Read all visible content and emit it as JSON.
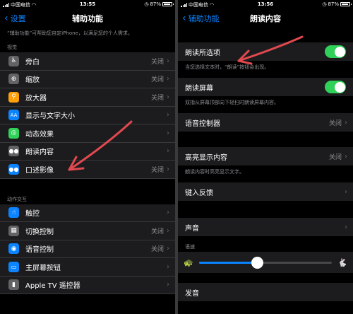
{
  "left": {
    "status": {
      "carrier": "中国电信",
      "time": "13:55",
      "battery": "87%"
    },
    "nav": {
      "back": "设置",
      "title": "辅助功能"
    },
    "description": "“辅助功能”可帮助您自定iPhone，以满足您的个人需求。",
    "vision_label": "视觉",
    "vision_items": [
      {
        "label": "旁白",
        "value": "关闭",
        "icon": "voiceover-icon",
        "color": "#636366",
        "glyph": "♿"
      },
      {
        "label": "缩放",
        "value": "关闭",
        "icon": "zoom-icon",
        "color": "#636366",
        "glyph": "⊕"
      },
      {
        "label": "放大器",
        "value": "关闭",
        "icon": "magnifier-icon",
        "color": "#ff9f0a",
        "glyph": "⚲"
      },
      {
        "label": "显示与文字大小",
        "value": "",
        "icon": "text-size-icon",
        "color": "#0a84ff",
        "glyph": "AA"
      },
      {
        "label": "动态效果",
        "value": "",
        "icon": "motion-icon",
        "color": "#30d158",
        "glyph": "◎"
      },
      {
        "label": "朗读内容",
        "value": "",
        "icon": "spoken-content-icon",
        "color": "#636366",
        "glyph": "💬"
      },
      {
        "label": "口述影像",
        "value": "关闭",
        "icon": "audio-description-icon",
        "color": "#0a84ff",
        "glyph": "💬"
      }
    ],
    "interaction_label": "动作交互",
    "interaction_items": [
      {
        "label": "触控",
        "value": "",
        "icon": "touch-icon",
        "color": "#0a84ff",
        "glyph": "☝"
      },
      {
        "label": "切换控制",
        "value": "关闭",
        "icon": "switch-control-icon",
        "color": "#636366",
        "glyph": "▦"
      },
      {
        "label": "语音控制",
        "value": "关闭",
        "icon": "voice-control-icon",
        "color": "#0a84ff",
        "glyph": "◉"
      },
      {
        "label": "主屏幕按钮",
        "value": "",
        "icon": "home-button-icon",
        "color": "#0a84ff",
        "glyph": "⬜"
      },
      {
        "label": "Apple TV 遥控器",
        "value": "",
        "icon": "remote-icon",
        "color": "#636366",
        "glyph": "▮"
      }
    ]
  },
  "right": {
    "status": {
      "carrier": "中国电信",
      "time": "13:56",
      "battery": "87%"
    },
    "nav": {
      "back": "辅助功能",
      "title": "朗读内容"
    },
    "speak_selection": {
      "label": "朗读所选项",
      "note": "当您选择文本时，“朗读”按钮会出现。"
    },
    "speak_screen": {
      "label": "朗读屏幕",
      "note": "双指从屏幕顶部向下轻扫时朗读屏幕内容。"
    },
    "speech_controller": {
      "label": "语音控制器",
      "value": "关闭"
    },
    "highlight": {
      "label": "高亮显示内容",
      "value": "关闭",
      "note": "朗读内容时高亮显示文字。"
    },
    "typing_feedback": {
      "label": "键入反馈"
    },
    "voices": {
      "label": "声音"
    },
    "rate_label": "语速",
    "rate_value": 0.44,
    "partial_label": "发音"
  },
  "colors": {
    "accent": "#0a84ff",
    "toggle_on": "#30d158",
    "annotation": "#e0494f"
  }
}
